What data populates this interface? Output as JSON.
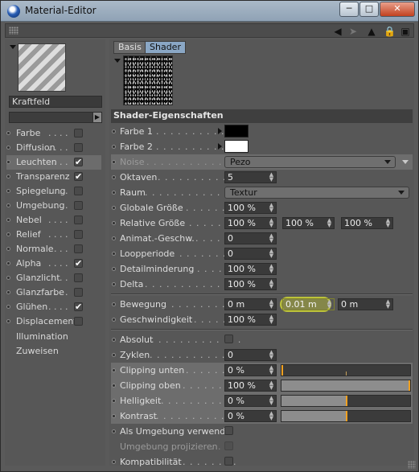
{
  "window": {
    "title": "Material-Editor"
  },
  "left": {
    "material_name": "Kraftfeld",
    "channels": [
      {
        "label": "Farbe",
        "checked": false
      },
      {
        "label": "Diffusion",
        "checked": false
      },
      {
        "label": "Leuchten",
        "checked": true
      },
      {
        "label": "Transparenz",
        "checked": true
      },
      {
        "label": "Spiegelung",
        "checked": false
      },
      {
        "label": "Umgebung",
        "checked": false
      },
      {
        "label": "Nebel",
        "checked": false
      },
      {
        "label": "Relief",
        "checked": false
      },
      {
        "label": "Normale",
        "checked": false
      },
      {
        "label": "Alpha",
        "checked": true
      },
      {
        "label": "Glanzlicht",
        "checked": false
      },
      {
        "label": "Glanzfarbe",
        "checked": false
      },
      {
        "label": "Glühen",
        "checked": true
      },
      {
        "label": "Displacement",
        "checked": false
      }
    ],
    "extra": [
      "Illumination",
      "Zuweisen"
    ]
  },
  "right": {
    "tabs": [
      "Basis",
      "Shader"
    ],
    "section_title": "Shader-Eigenschaften",
    "props": {
      "farbe1": {
        "label": "Farbe 1",
        "color": "#000000"
      },
      "farbe2": {
        "label": "Farbe 2",
        "color": "#ffffff"
      },
      "noise": {
        "label": "Noise",
        "value": "Pezo"
      },
      "oktaven": {
        "label": "Oktaven",
        "value": "5"
      },
      "raum": {
        "label": "Raum",
        "value": "Textur"
      },
      "globale": {
        "label": "Globale Größe",
        "value": "100 %"
      },
      "relative": {
        "label": "Relative Größe",
        "values": [
          "100 %",
          "100 %",
          "100 %"
        ]
      },
      "animat": {
        "label": "Animat.-Geschw.",
        "value": "0"
      },
      "loop": {
        "label": "Loopperiode",
        "value": "0"
      },
      "detail": {
        "label": "Detailminderung",
        "value": "100 %"
      },
      "delta": {
        "label": "Delta",
        "value": "100 %"
      },
      "bewegung": {
        "label": "Bewegung",
        "values": [
          "0 m",
          "0.01 m",
          "0 m"
        ]
      },
      "geschw": {
        "label": "Geschwindigkeit",
        "value": "100 %"
      },
      "absolut": {
        "label": "Absolut"
      },
      "zyklen": {
        "label": "Zyklen",
        "value": "0"
      },
      "clip_unten": {
        "label": "Clipping unten",
        "value": "0 %",
        "level": 0.0
      },
      "clip_oben": {
        "label": "Clipping oben",
        "value": "100 %",
        "level": 1.0
      },
      "hell": {
        "label": "Helligkeit",
        "value": "0 %",
        "level": 0.5
      },
      "kontrast": {
        "label": "Kontrast",
        "value": "0 %",
        "level": 0.5
      },
      "als_umg": {
        "label": "Als Umgebung verwenden"
      },
      "umg_proj": {
        "label": "Umgebung projizieren"
      },
      "kompat": {
        "label": "Kompatibilität"
      }
    }
  },
  "colors": {
    "accent": "#8aa7c5",
    "marker": "#f0a020",
    "highlight": "#bcc23a"
  }
}
